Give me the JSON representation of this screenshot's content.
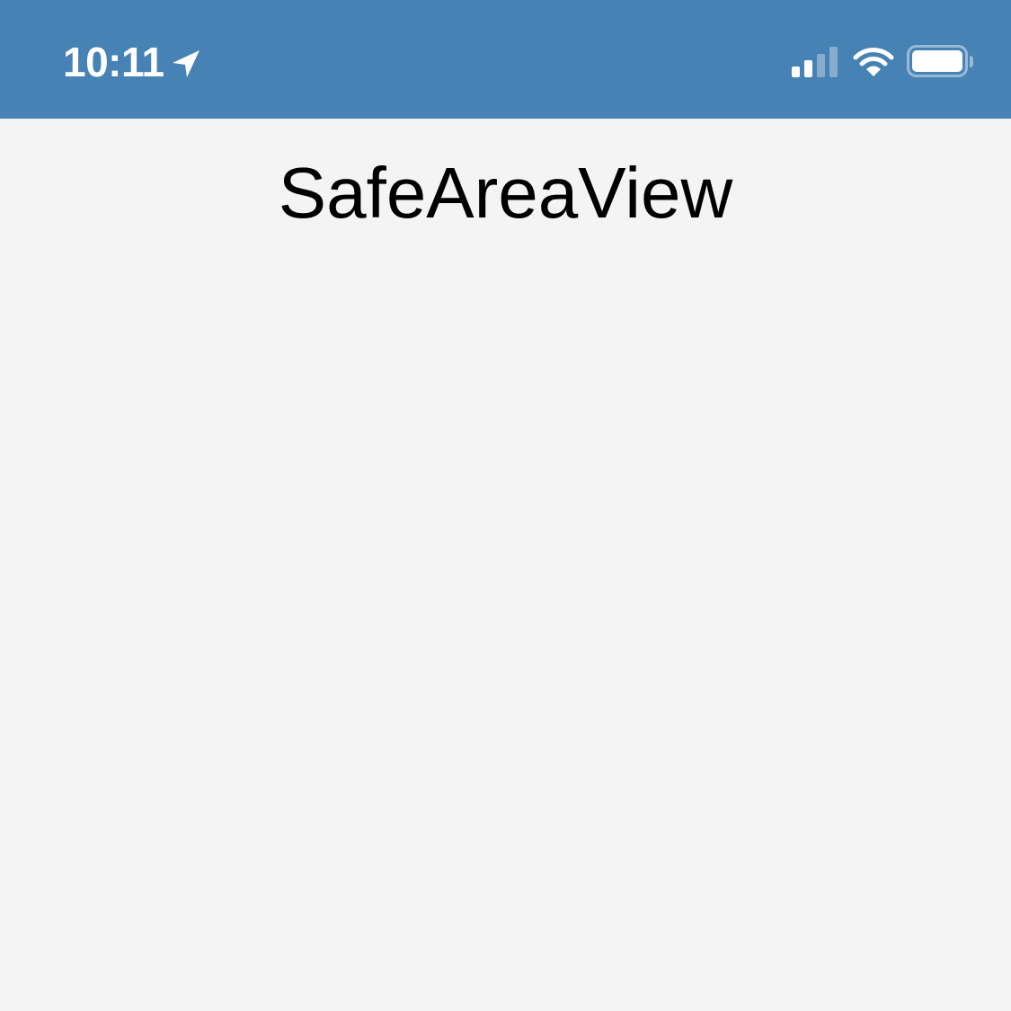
{
  "status_bar": {
    "time": "10:11",
    "background_color": "#4682b4",
    "icons": {
      "location": "location-arrow-icon",
      "signal": "cellular-signal-icon",
      "wifi": "wifi-icon",
      "battery": "battery-icon"
    }
  },
  "main": {
    "title": "SafeAreaView",
    "background_color": "#f4f4f4"
  }
}
